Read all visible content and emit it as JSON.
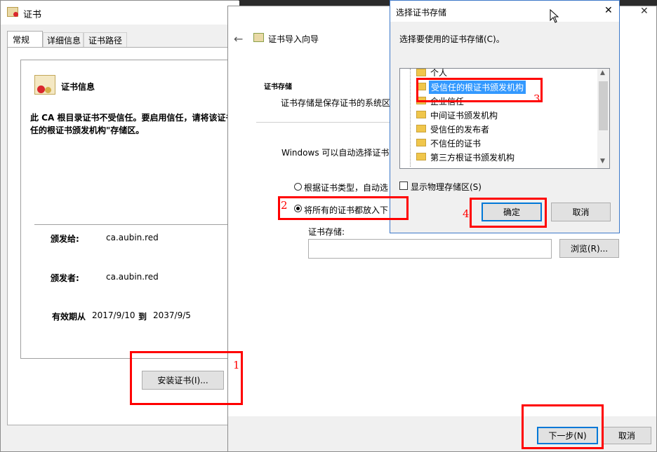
{
  "cert_window": {
    "title": "证书",
    "title_overflow": "",
    "tabs": [
      "常规",
      "详细信息",
      "证书路径"
    ],
    "info_heading": "证书信息",
    "warning_line1": "此 CA 根目录证书不受信任。要启用信任，请将该证书",
    "warning_line2": "任的根证书颁发机构\"存储区。",
    "issued_to_label": "颁发给:",
    "issued_to": "ca.aubin.red",
    "issued_by_label": "颁发者:",
    "issued_by": "ca.aubin.red",
    "valid_from_label": "有效期从",
    "valid_from": "2017/9/10",
    "valid_to_label": "到",
    "valid_to": "2037/9/5",
    "install_button": "安装证书(I)..."
  },
  "wizard": {
    "back_icon": "back-arrow-icon",
    "title": "证书导入向导",
    "section_title": "证书存储",
    "section_desc": "证书存储是保存证书的系统区",
    "auto_text": "Windows 可以自动选择证书",
    "radio_auto": "根据证书类型，自动选",
    "radio_manual": "将所有的证书都放入下",
    "store_label": "证书存储:",
    "store_value": "",
    "browse_button": "浏览(R)...",
    "next_button": "下一步(N)",
    "cancel_button": "取消"
  },
  "store_dialog": {
    "title": "选择证书存储",
    "prompt": "选择要使用的证书存储(C)。",
    "items": [
      "个人",
      "受信任的根证书颁发机构",
      "企业信任",
      "中间证书颁发机构",
      "受信任的发布者",
      "不信任的证书",
      "第三方根证书颁发机构"
    ],
    "selected_index": 1,
    "show_physical": "显示物理存储区(S)",
    "ok_button": "确定",
    "cancel_button": "取消"
  },
  "annotations": [
    "1",
    "2",
    "3",
    "4"
  ],
  "colors": {
    "annotation": "#ff0000",
    "selection": "#3399ff",
    "accent": "#0078d7"
  }
}
